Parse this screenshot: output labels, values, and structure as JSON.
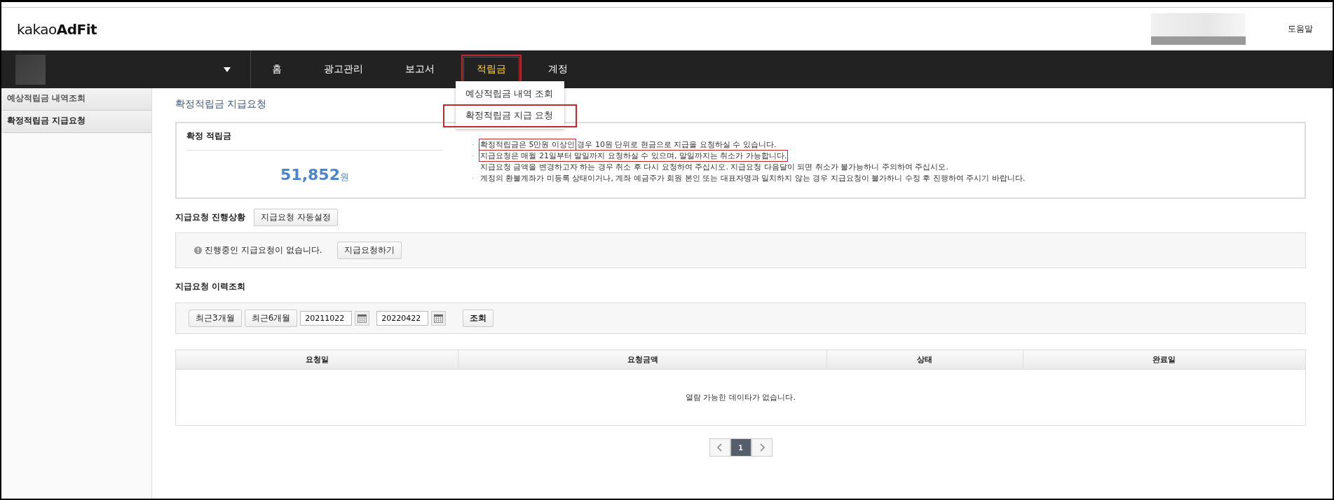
{
  "header": {
    "logo": {
      "light": "kakao",
      "bold": "AdFit"
    },
    "help_link": "도움말"
  },
  "nav": {
    "items": [
      {
        "label": "홈",
        "selected": false,
        "annotated": false
      },
      {
        "label": "광고관리",
        "selected": false,
        "annotated": false
      },
      {
        "label": "보고서",
        "selected": false,
        "annotated": false
      },
      {
        "label": "적립금",
        "selected": true,
        "annotated": true
      },
      {
        "label": "계정",
        "selected": false,
        "annotated": false
      }
    ],
    "dropdown": {
      "items": [
        {
          "label": "예상적립금 내역 조회",
          "annotated": false
        },
        {
          "label": "확정적립금 지급 요청",
          "annotated": true
        }
      ]
    }
  },
  "sidebar": {
    "items": [
      {
        "label": "예상적립금 내역조회",
        "selected": false
      },
      {
        "label": "확정적립금 지급요청",
        "selected": true
      }
    ]
  },
  "page_title": "확정적립금 지급요청",
  "balance": {
    "label": "확정 적립금",
    "amount": "51,852",
    "unit": "원"
  },
  "notices": [
    {
      "bullet": "·",
      "marked": "확정적립금은 5만원 이상인",
      "text": " 경우 10원 단위로 현금으로 지급을 요청하실 수 있습니다."
    },
    {
      "bullet": "·",
      "marked": "지급요청은 매월 21일부터 말일까지 요청하실 수 있으며, 말일까지는 취소가 가능합니다."
    },
    {
      "text": "지급요청 금액을 변경하고자 하는 경우 취소 후 다시 요청하여 주십시오. 지급요청 다음달이 되면 취소가 불가능하니 주의하여 주십시오."
    },
    {
      "bullet": "·",
      "text": "계정의 환불계좌가 미등록 상태이거나, 계좌 예금주가 회원 본인 또는 대표자명과 일치하지 않는 경우 지급요청이 불가하니 수정 후 진행하여 주시기 바랍니다."
    }
  ],
  "progress": {
    "heading": "지급요청 진행상황",
    "auto_button": "지급요청 자동설정",
    "message": "진행중인 지급요청이 없습니다.",
    "request_button": "지급요청하기"
  },
  "history": {
    "heading": "지급요청 이력조회",
    "range_buttons": [
      "최근3개월",
      "최근6개월"
    ],
    "start_date": "20211022",
    "end_date": "20220422",
    "search_button": "조회"
  },
  "table": {
    "columns": [
      "요청일",
      "요청금액",
      "상태",
      "완료일"
    ],
    "empty_message": "열람 가능한 데이타가 없습니다."
  },
  "pagination": {
    "pages": [
      {
        "label": "1",
        "selected": true
      }
    ]
  }
}
